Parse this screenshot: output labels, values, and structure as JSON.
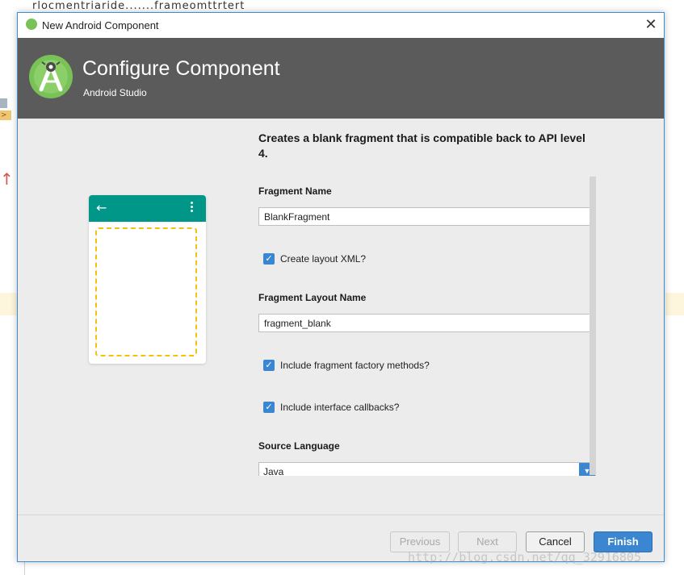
{
  "window": {
    "title": "New Android Component",
    "close_glyph": "✕",
    "icon": "android-studio-icon"
  },
  "header": {
    "title": "Configure Component",
    "subtitle": "Android Studio",
    "logo": "android-studio-logo"
  },
  "preview": {
    "back_glyph": "←"
  },
  "form": {
    "description": "Creates a blank fragment that is compatible back to API level 4.",
    "fragment_name_label": "Fragment Name",
    "fragment_name_value": "BlankFragment",
    "create_layout_label": "Create layout XML?",
    "create_layout_checked": true,
    "layout_name_label": "Fragment Layout Name",
    "layout_name_value": "fragment_blank",
    "factory_methods_label": "Include fragment factory methods?",
    "factory_methods_checked": true,
    "interface_callbacks_label": "Include interface callbacks?",
    "interface_callbacks_checked": true,
    "source_language_label": "Source Language",
    "source_language_value": "Java",
    "check_glyph": "✓"
  },
  "buttons": {
    "previous": "Previous",
    "next": "Next",
    "cancel": "Cancel",
    "finish": "Finish"
  },
  "watermark": "http://blog.csdn.net/qq_32916805",
  "colors": {
    "accent": "#3b86d1",
    "header_bg": "#5b5b5b",
    "preview_appbar": "#009688",
    "fragment_outline": "#f4c20d",
    "android_green": "#78c257"
  }
}
